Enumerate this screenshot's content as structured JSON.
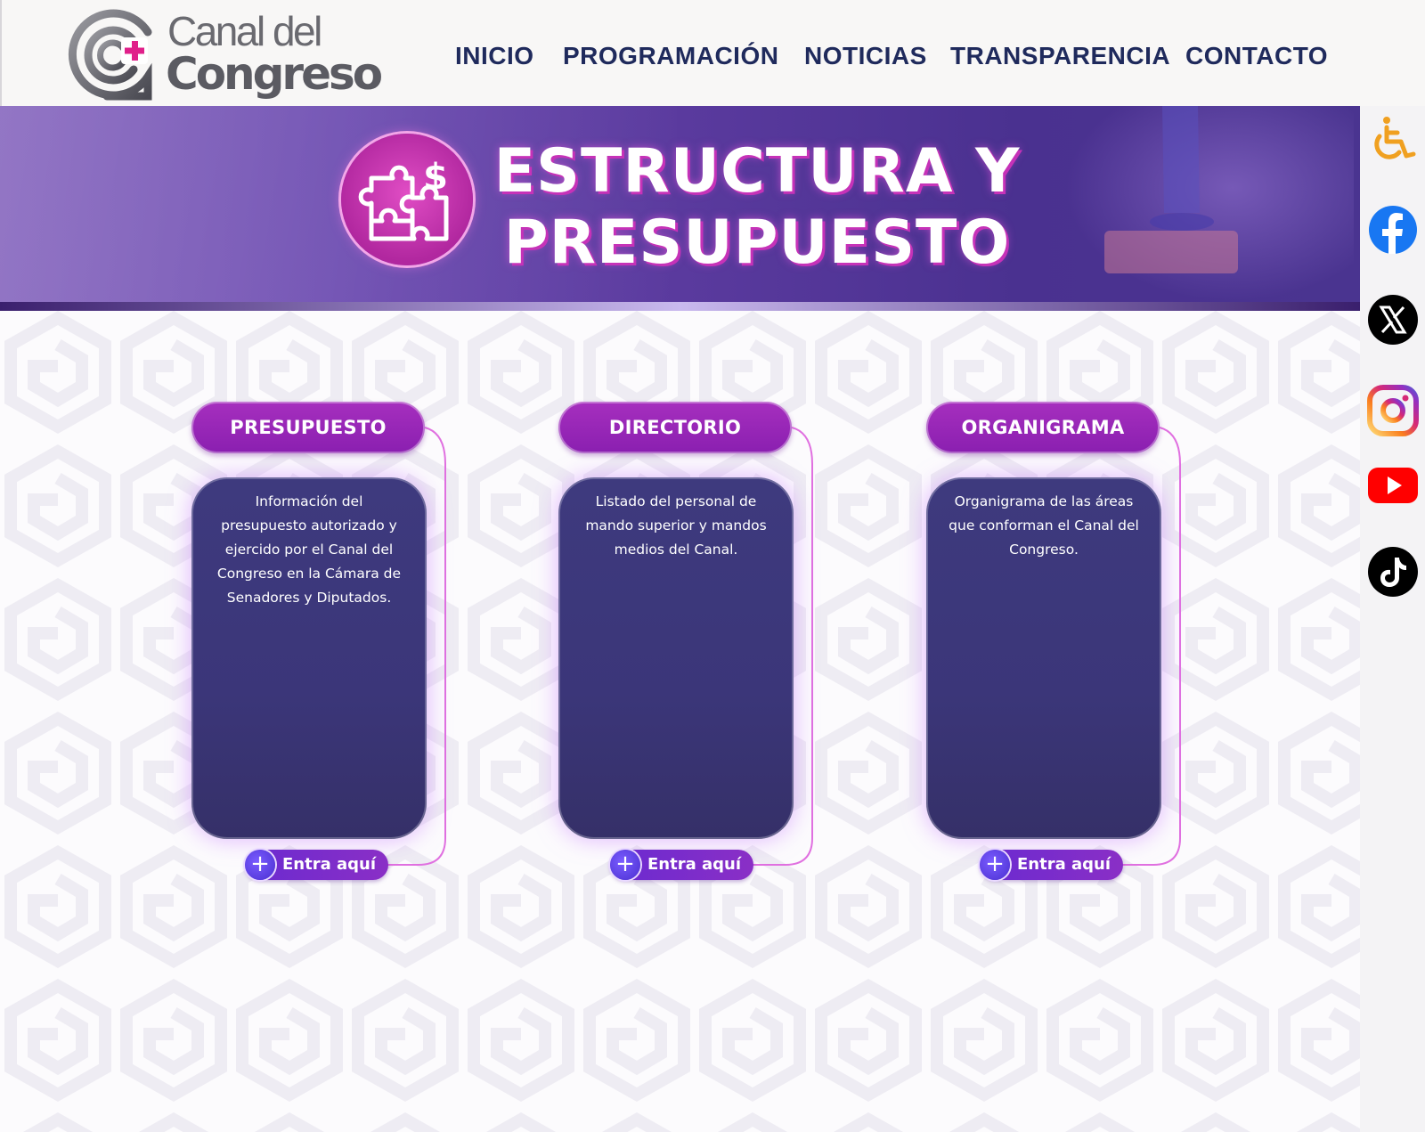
{
  "header": {
    "logo": {
      "line1": "Canal del",
      "line2": "Congreso"
    },
    "nav": [
      {
        "label": "INICIO"
      },
      {
        "label": "PROGRAMACIÓN"
      },
      {
        "label": "NOTICIAS"
      },
      {
        "label": "TRANSPARENCIA"
      },
      {
        "label": "CONTACTO"
      }
    ]
  },
  "banner": {
    "title_line1": "ESTRUCTURA Y",
    "title_line2": "PRESUPUESTO",
    "icon": "puzzle-dollar-icon"
  },
  "cards": [
    {
      "title": "PRESUPUESTO",
      "description": "Información del presupuesto autorizado y ejercido por el Canal del Congreso en la Cámara de Senadores y Diputados.",
      "button": "Entra aquí"
    },
    {
      "title": "DIRECTORIO",
      "description": "Listado del personal de mando superior y mandos medios del Canal.",
      "button": "Entra aquí"
    },
    {
      "title": "ORGANIGRAMA",
      "description": "Organigrama de las áreas que conforman el Canal del Congreso.",
      "button": "Entra aquí"
    }
  ],
  "social": [
    {
      "icon": "accessibility-icon",
      "color": "#f0a020"
    },
    {
      "icon": "facebook-icon",
      "color": "#1877f2"
    },
    {
      "icon": "x-icon",
      "color": "#000000"
    },
    {
      "icon": "instagram-icon",
      "color": "#e1306c"
    },
    {
      "icon": "youtube-icon",
      "color": "#ff0000"
    },
    {
      "icon": "tiktok-icon",
      "color": "#000000"
    }
  ],
  "colors": {
    "nav_text": "#1f2a5c",
    "tab_purple": "#9a27b8",
    "card_body": "#3b3679",
    "banner_purple": "#5a3a9e"
  }
}
